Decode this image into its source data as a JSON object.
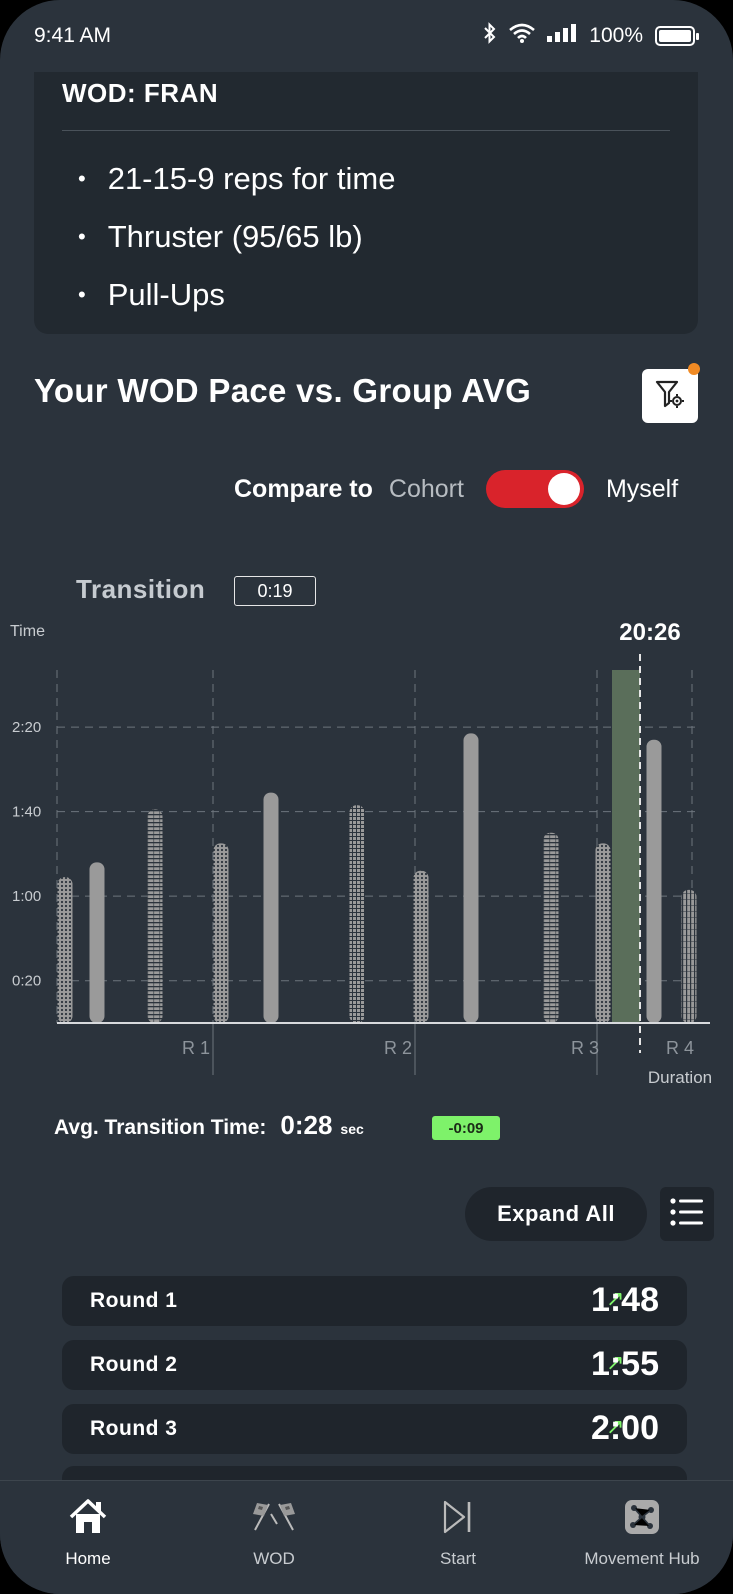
{
  "status_bar": {
    "time": "9:41 AM",
    "battery": "100%"
  },
  "wod": {
    "title": "WOD: FRAN",
    "items": [
      "21-15-9 reps for time",
      "Thruster (95/65 lb)",
      "Pull-Ups"
    ]
  },
  "pace": {
    "title": "Your WOD Pace vs. Group AVG"
  },
  "compare": {
    "label": "Compare to",
    "option_left": "Cohort",
    "option_right": "Myself",
    "toggle_on": true
  },
  "transition": {
    "label": "Transition",
    "value": "0:19"
  },
  "colors": {
    "accent_red": "#d9232b",
    "positive_green": "#7ef26a",
    "filter_dot": "#f08a24"
  },
  "chart_data": {
    "type": "bar",
    "ylabel": "Time",
    "xlabel": "Duration",
    "y_ticks": [
      "0:20",
      "1:00",
      "1:40",
      "2:20"
    ],
    "y_tick_values": [
      20,
      60,
      100,
      140
    ],
    "ylim": [
      0,
      167
    ],
    "rounds": [
      "R 1",
      "R 2",
      "R 3",
      "R 4"
    ],
    "marker_label": "20:26",
    "bars": [
      {
        "round": "R 1",
        "pattern": "dots",
        "value": 69
      },
      {
        "round": "R 1",
        "pattern": "solid",
        "value": 76
      },
      {
        "round": "R 1",
        "pattern": "hlines",
        "value": 101
      },
      {
        "round": "R 1",
        "pattern": "dots",
        "value": 85
      },
      {
        "round": "R 2",
        "pattern": "solid",
        "value": 109
      },
      {
        "round": "R 2",
        "pattern": "grid",
        "value": 103
      },
      {
        "round": "R 2",
        "pattern": "dots",
        "value": 72
      },
      {
        "round": "R 2",
        "pattern": "solid",
        "value": 137
      },
      {
        "round": "R 3",
        "pattern": "hlines",
        "value": 90
      },
      {
        "round": "R 3",
        "pattern": "dots",
        "value": 85
      },
      {
        "round": "R 3",
        "pattern": "highlight",
        "value": 167
      },
      {
        "round": "R 4",
        "pattern": "solid",
        "value": 134
      },
      {
        "round": "R 4",
        "pattern": "vlines",
        "value": 63
      }
    ]
  },
  "avg_transition": {
    "label": "Avg. Transition Time:",
    "value": "0:28",
    "unit": "sec",
    "delta": "-0:09"
  },
  "actions": {
    "expand_all": "Expand All"
  },
  "rounds": [
    {
      "name": "Round 1",
      "time": "1:48",
      "trend": "↗"
    },
    {
      "name": "Round 2",
      "time": "1:55",
      "trend": "↗"
    },
    {
      "name": "Round 3",
      "time": "2:00",
      "trend": "↗"
    }
  ],
  "nav": [
    {
      "label": "Home",
      "icon": "home-icon",
      "active": true
    },
    {
      "label": "WOD",
      "icon": "checkered-flags-icon",
      "active": false
    },
    {
      "label": "Start",
      "icon": "skip-forward-icon",
      "active": false
    },
    {
      "label": "Movement Hub",
      "icon": "molecule-icon",
      "active": false
    }
  ]
}
